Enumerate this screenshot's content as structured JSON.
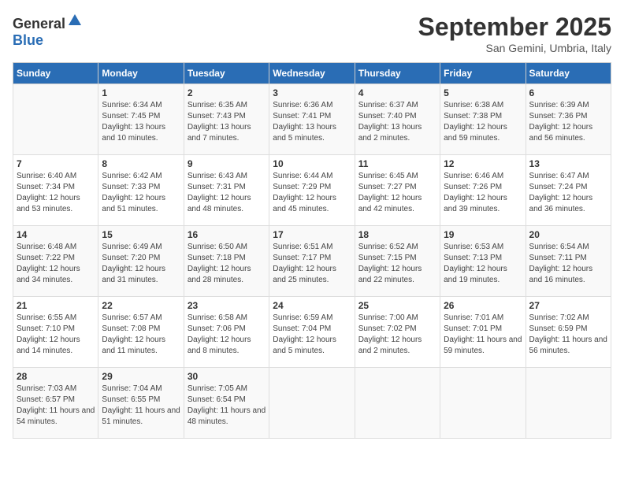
{
  "header": {
    "logo_general": "General",
    "logo_blue": "Blue",
    "month_title": "September 2025",
    "location": "San Gemini, Umbria, Italy"
  },
  "days_of_week": [
    "Sunday",
    "Monday",
    "Tuesday",
    "Wednesday",
    "Thursday",
    "Friday",
    "Saturday"
  ],
  "weeks": [
    [
      {
        "day": "",
        "sunrise": "",
        "sunset": "",
        "daylight": ""
      },
      {
        "day": "1",
        "sunrise": "Sunrise: 6:34 AM",
        "sunset": "Sunset: 7:45 PM",
        "daylight": "Daylight: 13 hours and 10 minutes."
      },
      {
        "day": "2",
        "sunrise": "Sunrise: 6:35 AM",
        "sunset": "Sunset: 7:43 PM",
        "daylight": "Daylight: 13 hours and 7 minutes."
      },
      {
        "day": "3",
        "sunrise": "Sunrise: 6:36 AM",
        "sunset": "Sunset: 7:41 PM",
        "daylight": "Daylight: 13 hours and 5 minutes."
      },
      {
        "day": "4",
        "sunrise": "Sunrise: 6:37 AM",
        "sunset": "Sunset: 7:40 PM",
        "daylight": "Daylight: 13 hours and 2 minutes."
      },
      {
        "day": "5",
        "sunrise": "Sunrise: 6:38 AM",
        "sunset": "Sunset: 7:38 PM",
        "daylight": "Daylight: 12 hours and 59 minutes."
      },
      {
        "day": "6",
        "sunrise": "Sunrise: 6:39 AM",
        "sunset": "Sunset: 7:36 PM",
        "daylight": "Daylight: 12 hours and 56 minutes."
      }
    ],
    [
      {
        "day": "7",
        "sunrise": "Sunrise: 6:40 AM",
        "sunset": "Sunset: 7:34 PM",
        "daylight": "Daylight: 12 hours and 53 minutes."
      },
      {
        "day": "8",
        "sunrise": "Sunrise: 6:42 AM",
        "sunset": "Sunset: 7:33 PM",
        "daylight": "Daylight: 12 hours and 51 minutes."
      },
      {
        "day": "9",
        "sunrise": "Sunrise: 6:43 AM",
        "sunset": "Sunset: 7:31 PM",
        "daylight": "Daylight: 12 hours and 48 minutes."
      },
      {
        "day": "10",
        "sunrise": "Sunrise: 6:44 AM",
        "sunset": "Sunset: 7:29 PM",
        "daylight": "Daylight: 12 hours and 45 minutes."
      },
      {
        "day": "11",
        "sunrise": "Sunrise: 6:45 AM",
        "sunset": "Sunset: 7:27 PM",
        "daylight": "Daylight: 12 hours and 42 minutes."
      },
      {
        "day": "12",
        "sunrise": "Sunrise: 6:46 AM",
        "sunset": "Sunset: 7:26 PM",
        "daylight": "Daylight: 12 hours and 39 minutes."
      },
      {
        "day": "13",
        "sunrise": "Sunrise: 6:47 AM",
        "sunset": "Sunset: 7:24 PM",
        "daylight": "Daylight: 12 hours and 36 minutes."
      }
    ],
    [
      {
        "day": "14",
        "sunrise": "Sunrise: 6:48 AM",
        "sunset": "Sunset: 7:22 PM",
        "daylight": "Daylight: 12 hours and 34 minutes."
      },
      {
        "day": "15",
        "sunrise": "Sunrise: 6:49 AM",
        "sunset": "Sunset: 7:20 PM",
        "daylight": "Daylight: 12 hours and 31 minutes."
      },
      {
        "day": "16",
        "sunrise": "Sunrise: 6:50 AM",
        "sunset": "Sunset: 7:18 PM",
        "daylight": "Daylight: 12 hours and 28 minutes."
      },
      {
        "day": "17",
        "sunrise": "Sunrise: 6:51 AM",
        "sunset": "Sunset: 7:17 PM",
        "daylight": "Daylight: 12 hours and 25 minutes."
      },
      {
        "day": "18",
        "sunrise": "Sunrise: 6:52 AM",
        "sunset": "Sunset: 7:15 PM",
        "daylight": "Daylight: 12 hours and 22 minutes."
      },
      {
        "day": "19",
        "sunrise": "Sunrise: 6:53 AM",
        "sunset": "Sunset: 7:13 PM",
        "daylight": "Daylight: 12 hours and 19 minutes."
      },
      {
        "day": "20",
        "sunrise": "Sunrise: 6:54 AM",
        "sunset": "Sunset: 7:11 PM",
        "daylight": "Daylight: 12 hours and 16 minutes."
      }
    ],
    [
      {
        "day": "21",
        "sunrise": "Sunrise: 6:55 AM",
        "sunset": "Sunset: 7:10 PM",
        "daylight": "Daylight: 12 hours and 14 minutes."
      },
      {
        "day": "22",
        "sunrise": "Sunrise: 6:57 AM",
        "sunset": "Sunset: 7:08 PM",
        "daylight": "Daylight: 12 hours and 11 minutes."
      },
      {
        "day": "23",
        "sunrise": "Sunrise: 6:58 AM",
        "sunset": "Sunset: 7:06 PM",
        "daylight": "Daylight: 12 hours and 8 minutes."
      },
      {
        "day": "24",
        "sunrise": "Sunrise: 6:59 AM",
        "sunset": "Sunset: 7:04 PM",
        "daylight": "Daylight: 12 hours and 5 minutes."
      },
      {
        "day": "25",
        "sunrise": "Sunrise: 7:00 AM",
        "sunset": "Sunset: 7:02 PM",
        "daylight": "Daylight: 12 hours and 2 minutes."
      },
      {
        "day": "26",
        "sunrise": "Sunrise: 7:01 AM",
        "sunset": "Sunset: 7:01 PM",
        "daylight": "Daylight: 11 hours and 59 minutes."
      },
      {
        "day": "27",
        "sunrise": "Sunrise: 7:02 AM",
        "sunset": "Sunset: 6:59 PM",
        "daylight": "Daylight: 11 hours and 56 minutes."
      }
    ],
    [
      {
        "day": "28",
        "sunrise": "Sunrise: 7:03 AM",
        "sunset": "Sunset: 6:57 PM",
        "daylight": "Daylight: 11 hours and 54 minutes."
      },
      {
        "day": "29",
        "sunrise": "Sunrise: 7:04 AM",
        "sunset": "Sunset: 6:55 PM",
        "daylight": "Daylight: 11 hours and 51 minutes."
      },
      {
        "day": "30",
        "sunrise": "Sunrise: 7:05 AM",
        "sunset": "Sunset: 6:54 PM",
        "daylight": "Daylight: 11 hours and 48 minutes."
      },
      {
        "day": "",
        "sunrise": "",
        "sunset": "",
        "daylight": ""
      },
      {
        "day": "",
        "sunrise": "",
        "sunset": "",
        "daylight": ""
      },
      {
        "day": "",
        "sunrise": "",
        "sunset": "",
        "daylight": ""
      },
      {
        "day": "",
        "sunrise": "",
        "sunset": "",
        "daylight": ""
      }
    ]
  ]
}
